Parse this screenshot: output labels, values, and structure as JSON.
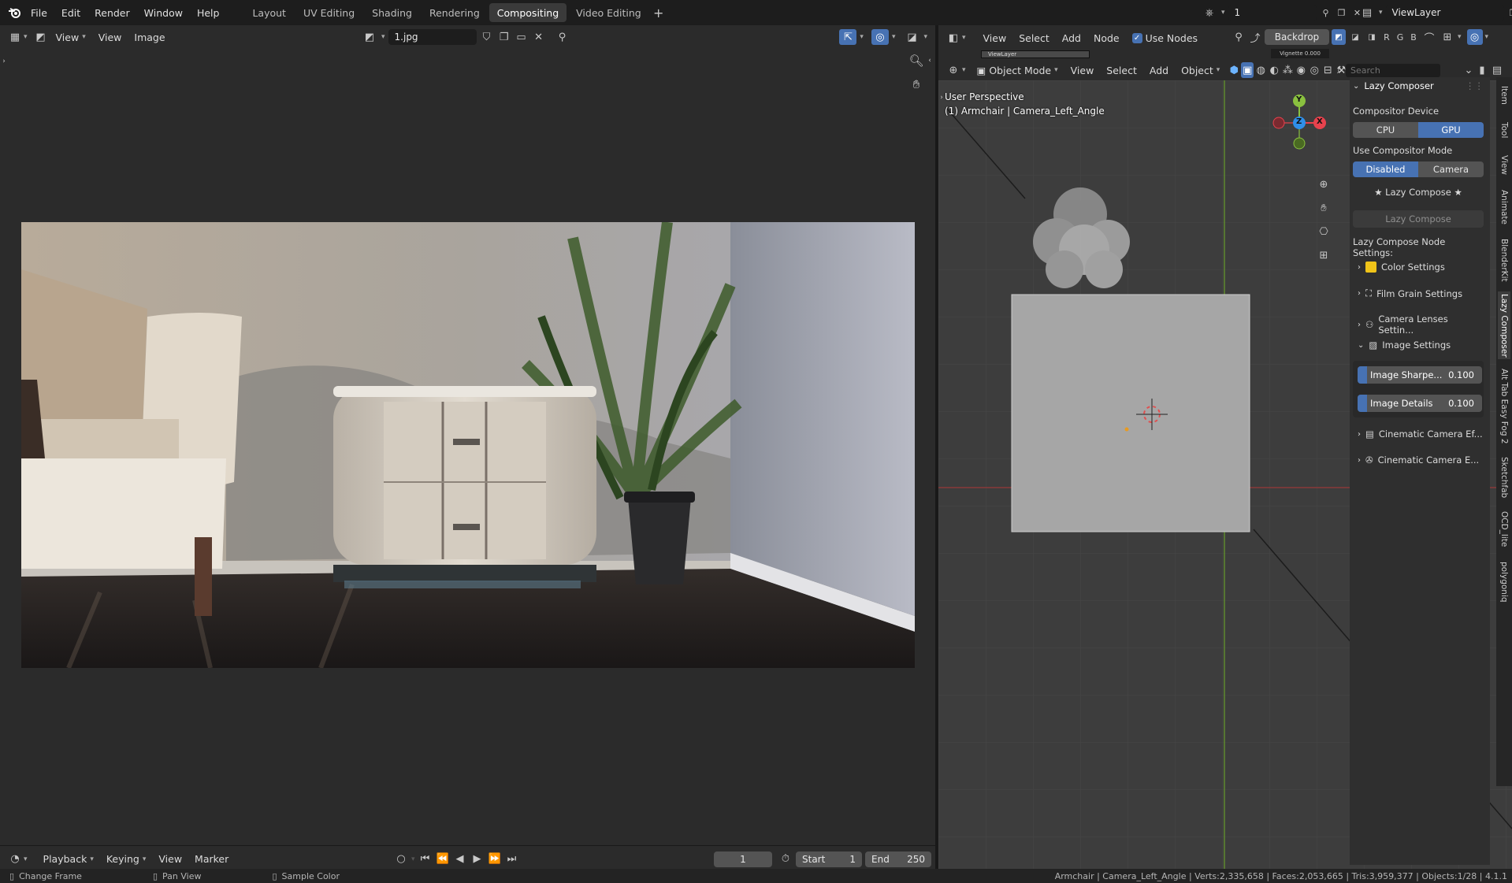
{
  "topbar": {
    "menus": [
      "File",
      "Edit",
      "Render",
      "Window",
      "Help"
    ],
    "workspaces": [
      "Layout",
      "UV Editing",
      "Shading",
      "Rendering",
      "Compositing",
      "Video Editing"
    ],
    "active_workspace": "Compositing",
    "scene_frame": "1",
    "view_layer": "ViewLayer"
  },
  "image_editor": {
    "header": {
      "view": "View",
      "view2": "View",
      "image": "Image",
      "filename": "1.jpg"
    }
  },
  "node_editor": {
    "header": {
      "view": "View",
      "select": "Select",
      "add": "Add",
      "node": "Node",
      "use_nodes": "Use Nodes",
      "backdrop": "Backdrop",
      "view_layer_mini": "ViewLayer",
      "vignette_mini": "Vignette 0.000"
    }
  },
  "viewport": {
    "header": {
      "mode": "Object Mode",
      "view": "View",
      "select": "Select",
      "add": "Add",
      "object": "Object",
      "search_placeholder": "Search"
    },
    "perspective": "User Perspective",
    "object_info": "(1) Armchair | Camera_Left_Angle",
    "gizmo": {
      "y": "Y",
      "z": "Z",
      "x": "X"
    }
  },
  "lazy_composer": {
    "title": "Lazy Composer",
    "device_label": "Compositor Device",
    "device_options": [
      "CPU",
      "GPU"
    ],
    "device_selected": "GPU",
    "mode_label": "Use Compositor Mode",
    "mode_options": [
      "Disabled",
      "Camera"
    ],
    "mode_selected": "Disabled",
    "star_label": "★ Lazy Compose ★",
    "compose_button": "Lazy Compose",
    "node_settings_label": "Lazy Compose Node Settings:",
    "sections": [
      {
        "label": "Color Settings",
        "icon": "color-swatch-icon",
        "expanded": false
      },
      {
        "label": "Film Grain Settings",
        "icon": "film-grain-icon",
        "expanded": false
      },
      {
        "label": "Camera Lenses Settin...",
        "icon": "camera-lens-icon",
        "expanded": false
      },
      {
        "label": "Image Settings",
        "icon": "image-icon",
        "expanded": true
      }
    ],
    "image_settings": [
      {
        "label": "Image Sharpe...",
        "value": "0.100"
      },
      {
        "label": "Image Details",
        "value": "0.100"
      }
    ],
    "more_sections": [
      {
        "label": "Cinematic Camera Ef...",
        "icon": "film-strip-icon"
      },
      {
        "label": "Cinematic Camera E...",
        "icon": "camera-reel-icon"
      }
    ]
  },
  "side_tabs": [
    "Item",
    "Tool",
    "View",
    "Animate",
    "BlenderKit",
    "Lazy Composer",
    "Alt Tab Easy Fog 2",
    "Sketchfab",
    "OCD_lite",
    "polygoniq"
  ],
  "side_tab_active": "Lazy Composer",
  "timeline": {
    "playback": "Playback",
    "keying": "Keying",
    "view": "View",
    "marker": "Marker",
    "current_frame": "1",
    "start_label": "Start",
    "start_value": "1",
    "end_label": "End",
    "end_value": "250"
  },
  "status": {
    "left": [
      {
        "icon": "mouse-left-icon",
        "label": "Change Frame"
      },
      {
        "icon": "mouse-middle-icon",
        "label": "Pan View"
      },
      {
        "icon": "mouse-right-icon",
        "label": "Sample Color"
      }
    ],
    "stats": "Armchair | Camera_Left_Angle | Verts:2,335,658 | Faces:2,053,665 | Tris:3,959,377 | Objects:1/28 | 4.1.1"
  },
  "colors": {
    "accent": "#4772b3",
    "background": "#2b2b2b",
    "viewport_bg": "#3d3d3d",
    "axis_x": "#e8424d",
    "axis_y": "#8ac13f",
    "axis_z": "#2f8fe8"
  }
}
